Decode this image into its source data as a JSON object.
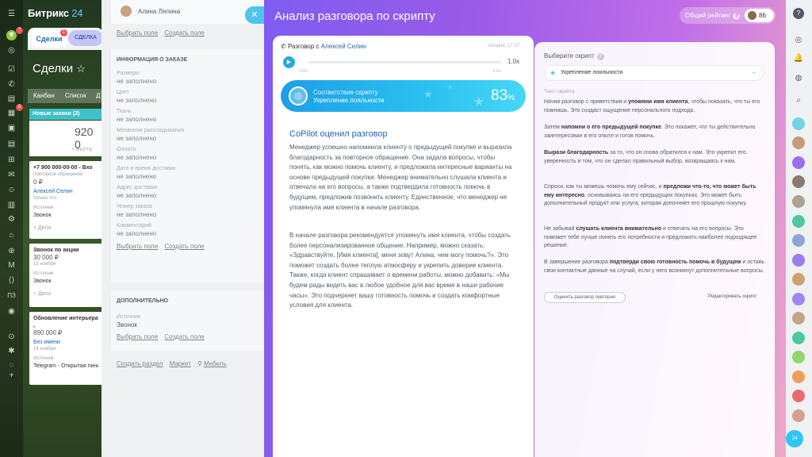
{
  "app": {
    "brand_name": "Битрикс",
    "brand_num": "24",
    "tabs": [
      {
        "label": "Сделки",
        "badge": "1"
      },
      {
        "label": "СДЕЛКА"
      }
    ],
    "page_title": "Сделки",
    "views": [
      "Канбан",
      "Список",
      "Д"
    ],
    "stage": {
      "title": "Новые заявки (3)",
      "sum": "920 0",
      "quick_add": "+ Быстр"
    },
    "nav_badges": [
      "7",
      "3"
    ],
    "bottom_nav_label": "ПЗ"
  },
  "cards": [
    {
      "title": "+7 900 000-00-00 - Вхо",
      "price": "0 ₽",
      "subtitle": "повторное обращение",
      "contact": "Алексей Селин",
      "time": "только что",
      "source_label": "Источник",
      "source": "Звонок",
      "add": "+ Дело"
    },
    {
      "title": "Звонок по акции",
      "price": "30 000 ₽",
      "date": "15 ноября",
      "source_label": "Источник",
      "source": "Звонок",
      "add": "+ Дело"
    },
    {
      "title": "Обновление интерьера ,",
      "price": "890 000 ₽",
      "contact": "Без имени",
      "date": "14 ноября",
      "source_label": "Источник",
      "source": "Telegram - Открытая лини"
    }
  ],
  "deal": {
    "contact_name": "Алина Лялина",
    "select_field": "Выбрать поле",
    "create_field": "Создать поле",
    "order_section": "ИНФОРМАЦИЯ О ЗАКАЗЕ",
    "fields": [
      {
        "label": "Размеры",
        "value": "не заполнено"
      },
      {
        "label": "Цвет",
        "value": "не заполнено"
      },
      {
        "label": "Ткань",
        "value": "не заполнено"
      },
      {
        "label": "Механизм раскладывания",
        "value": "не заполнено"
      },
      {
        "label": "Оплата",
        "value": "не заполнено"
      },
      {
        "label": "Дата и время доставки",
        "value": "не заполнено"
      },
      {
        "label": "Адрес доставки",
        "value": "не заполнено"
      },
      {
        "label": "Номер заказа",
        "value": "не заполнено"
      },
      {
        "label": "Комментарий",
        "value": "не заполнено"
      }
    ],
    "extra_section": "ДОПОЛНИТЕЛЬНО",
    "source_label": "Источник",
    "source_value": "Звонок",
    "create_section": "Создать раздел",
    "market": "Маркет",
    "furniture": "Мебель"
  },
  "slider": {
    "title": "Анализ разговора по скрипту",
    "rating_label": "Общий рейтинг",
    "rating_value": "86",
    "call": {
      "prefix": "Разговор с",
      "contact": "Алексей Селин",
      "time": "сегодня, 17:37",
      "speed": "1.0x",
      "start": "0:00",
      "end": "1:54"
    },
    "score": {
      "line1": "Соответствие скрипту",
      "line2": "Укрепление лояльности",
      "value": "83",
      "unit": "%"
    },
    "copilot_title": "CoPilot оценил разговор",
    "para1": "Менеджер успешно напомнила клиенту о предыдущей покупке и выразила благодарность за повторное обращение. Она задала вопросы, чтобы понять, как можно помочь клиенту, и предложила интересные варианты на основе предыдущей покупки. Менеджер внимательно слушала клиента и отвечала на его вопросы, а также подтвердила готовность помочь в будущем, предложив позвонить клиенту. Единственное, что менеджер не упомянула имя клиента в начале разговора.",
    "para2": "В начале разговора рекомендуется упомянуть имя клиента, чтобы создать более персонализированное общение. Например, можно сказать: «Здравствуйте, [Имя клиента], меня зовут Алина, чем могу помочь?». Это поможет создать более теплую атмосферу и укрепить доверие клиента. Также, когда клиент спрашивает о времени работы, можно добавить: «Мы будем рады видеть вас в любое удобное для вас время в наши рабочие часы». Это подчеркнет вашу готовность помочь и создать комфортные условия для клиента."
  },
  "script": {
    "choose_label": "Выберите скрипт",
    "selected": "Укрепление лояльности",
    "text_label": "Текст скрипта",
    "p1a": "Начни разговор с приветствия и ",
    "p1b": "упомяни имя клиента",
    "p1c": ", чтобы показать, что ты его помнишь. Это создаст ощущение персонального подхода.",
    "p2a": "Затем ",
    "p2b": "напомни о его предыдущей покупке",
    "p2c": ". Это покажет, что ты действительно заинтересован в его опыте и готов помочь.",
    "p3a": "",
    "p3b": "Вырази благодарность",
    "p3c": " за то, что он снова обратился к нам. Это укрепит его уверенность в том, что он сделал правильный выбор, возвращаясь к нам.",
    "p4a": "Спроси, как ты можешь помочь ему сейчас, и ",
    "p4b": "предложи что-то, что может быть ему интересно",
    "p4c": ", основываясь на его предыдущих покупках. Это может быть дополнительный продукт или услуга, которая дополняет его прошлую покупку.",
    "p5a": "Не забывай ",
    "p5b": "слушать клиента внимательно",
    "p5c": " и отвечать на его вопросы. Это поможет тебе лучше понять его потребности и предложить наиболее подходящее решение.",
    "p6a": "В завершение разговора ",
    "p6b": "подтверди свою готовность помочь в будущем",
    "p6c": " и оставь свои контактные данные на случай, если у него возникнут дополнительные вопросы.",
    "reassess_button": "Оценить разговор повторно",
    "edit_link": "Редактировать скрипт"
  },
  "rail": {
    "bottom_badge": "24"
  },
  "colors": {
    "accent": "#2066b0",
    "score_bar": "#2bc1f0",
    "slider_start": "#7f5cf1",
    "slider_end": "#f0a8c6"
  }
}
